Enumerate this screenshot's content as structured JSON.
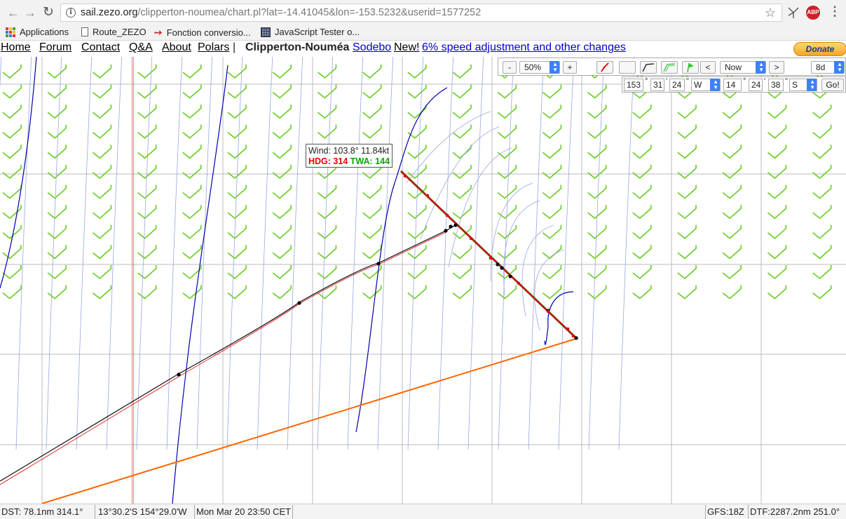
{
  "browser": {
    "url_host": "sail.zezo.org",
    "url_rest": "/clipperton-noumea/chart.pl?lat=-14.41045&lon=-153.5232&userid=1577252",
    "bookmarks": [
      "Applications",
      "Route_ZEZO",
      "Fonction conversio...",
      "JavaScript Tester o..."
    ],
    "abp_label": "ABP"
  },
  "site_nav": {
    "home": "Home",
    "forum": "Forum",
    "contact": "Contact",
    "qa": "Q&A",
    "about": "About",
    "polars": "Polars",
    "separator": "|",
    "race_name": "Clipperton-Nouméa",
    "sodebo": "Sodebo",
    "new_label": "New!",
    "news_link": "6% speed adjustment and other changes",
    "donate": "Donate"
  },
  "toolbar": {
    "zoom_out": "-",
    "zoom_value": "50%",
    "zoom_in": "+",
    "time_prev": "<",
    "time_value": "Now",
    "time_next": ">",
    "forecast_value": "8d"
  },
  "coords": {
    "lon_deg": "153",
    "deg_unit": "°",
    "lon_min": "31",
    "min_unit": "'",
    "lon_sec": "24",
    "sec_unit": "\"",
    "lon_hemi": "W",
    "lat_deg": "14",
    "lat_min": "24",
    "lat_sec": "38",
    "lat_hemi": "S",
    "go": "Go!"
  },
  "tooltip": {
    "wind": "Wind: 103.8° 11.84kt",
    "hdg": "HDG: 314",
    "twa": "TWA: 144"
  },
  "status": {
    "dst": "DST:  78.1nm 314.1°",
    "position": "13°30.2'S  154°29.0'W",
    "time": "Mon Mar 20 23:50 CET",
    "gfs": "GFS:18Z",
    "dtf": "DTF:2287.2nm 251.0°"
  },
  "colors": {
    "wind_barb": "#66cc22",
    "isochrone_blue": "#0000aa",
    "route_red": "#dd0000",
    "orthodromy": "#ff6600",
    "grid": "#bbbbbb"
  }
}
